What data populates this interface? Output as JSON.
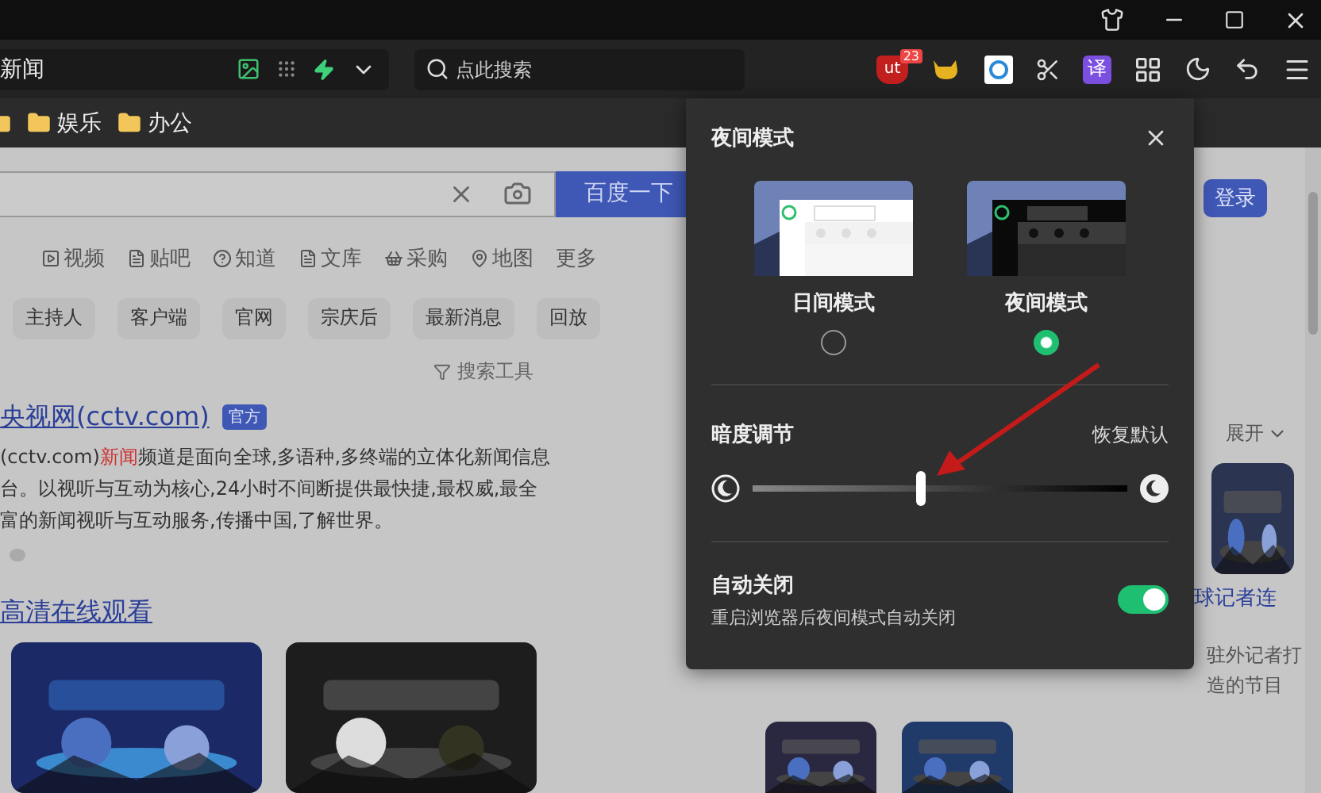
{
  "address_bar": {
    "value": "新闻"
  },
  "search_bar": {
    "placeholder": "点此搜索"
  },
  "extensions": {
    "badge_label": "ut",
    "badge_count": "23",
    "translate_label": "译"
  },
  "bookmarks": [
    {
      "label": "娱乐"
    },
    {
      "label": "办公"
    }
  ],
  "page": {
    "search_button": "百度一下",
    "login_button": "登录",
    "nav_tabs": [
      "视频",
      "贴吧",
      "知道",
      "文库",
      "采购",
      "地图",
      "更多"
    ],
    "chips": [
      "主持人",
      "客户端",
      "官网",
      "宗庆后",
      "最新消息",
      "回放"
    ],
    "search_tools": "搜索工具",
    "result": {
      "title": "央视网(cctv.com)",
      "badge": "官方",
      "lines": [
        {
          "before": "(cctv.com)",
          "highlight": "新闻",
          "after": "频道是面向全球,多语种,多终端的立体化新闻信息"
        },
        {
          "before": "台。以视听与互动为核心,24小时不间断提供最快捷,最权威,最全"
        },
        {
          "before": "富的新闻视听与互动服务,传播中国,了解世界。"
        }
      ]
    },
    "video_link": "高清在线观看",
    "expand": "展开",
    "side_card": {
      "title": "球记者连",
      "desc_lines": [
        "驻外记者打",
        "造的节目"
      ]
    }
  },
  "night_panel": {
    "title": "夜间模式",
    "modes": [
      {
        "label": "日间模式",
        "kind": "day",
        "selected": false
      },
      {
        "label": "夜间模式",
        "kind": "night",
        "selected": true
      }
    ],
    "brightness": {
      "label": "暗度调节",
      "reset": "恢复默认",
      "level": 0.45
    },
    "auto_off": {
      "label": "自动关闭",
      "description": "重启浏览器后夜间模式自动关闭",
      "on": true
    }
  }
}
